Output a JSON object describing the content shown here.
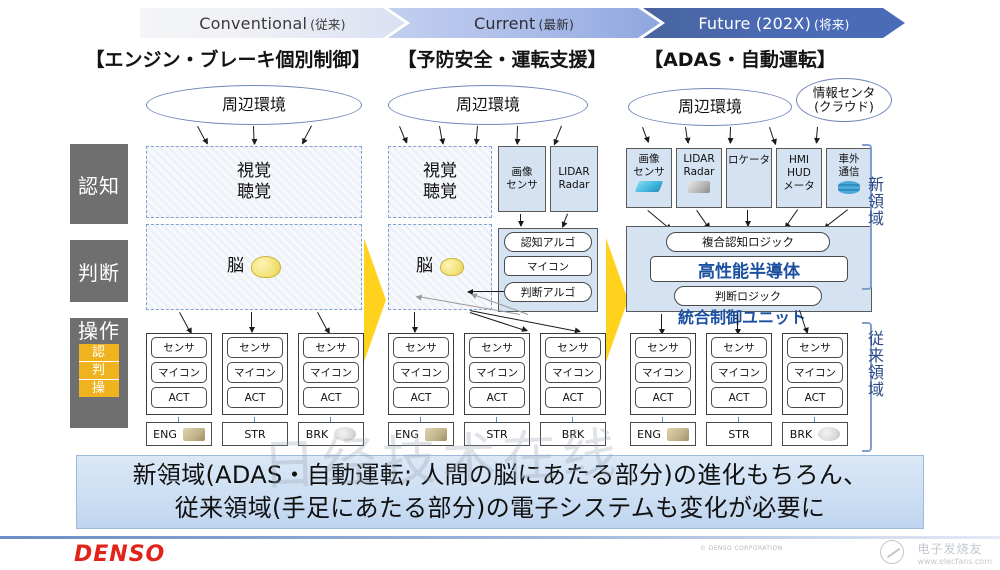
{
  "phases": [
    {
      "label": "Conventional",
      "sub": "(従来)"
    },
    {
      "label": "Current",
      "sub": "(最新)"
    },
    {
      "label": "Future (202X)",
      "sub": "(将来)"
    }
  ],
  "column_titles": [
    "【エンジン・ブレーキ個別制御】",
    "【予防安全・運転支援】",
    "【ADAS・自動運転】"
  ],
  "stage_labels": {
    "recognition": "認知",
    "judgment": "判断",
    "operation": "操作",
    "mini": [
      "認",
      "判",
      "操"
    ]
  },
  "common": {
    "environment": "周辺環境",
    "vision": "視覚",
    "hearing": "聴覚",
    "brain": "脳",
    "sensor": "センサ",
    "mcu": "マイコン",
    "act": "ACT",
    "eng": "ENG",
    "str": "STR",
    "brk": "BRK"
  },
  "column1": {
    "environment": "周辺環境",
    "sense_lines": [
      "視覚",
      "聴覚"
    ],
    "brain": "脳",
    "ecus": [
      {
        "rows": [
          "センサ",
          "マイコン",
          "ACT"
        ],
        "output": "ENG"
      },
      {
        "rows": [
          "センサ",
          "マイコン",
          "ACT"
        ],
        "output": "STR"
      },
      {
        "rows": [
          "センサ",
          "マイコン",
          "ACT"
        ],
        "output": "BRK"
      }
    ]
  },
  "column2": {
    "environment": "周辺環境",
    "sense_lines": [
      "視覚",
      "聴覚"
    ],
    "brain": "脳",
    "sensors": [
      {
        "lines": [
          "画像",
          "センサ"
        ]
      },
      {
        "lines": [
          "LIDAR",
          "Radar"
        ]
      }
    ],
    "ecu_block": [
      "認知アルゴ",
      "マイコン",
      "判断アルゴ"
    ],
    "ecus": [
      {
        "rows": [
          "センサ",
          "マイコン",
          "ACT"
        ],
        "output": "ENG"
      },
      {
        "rows": [
          "センサ",
          "マイコン",
          "ACT"
        ],
        "output": "STR"
      },
      {
        "rows": [
          "センサ",
          "マイコン",
          "ACT"
        ],
        "output": "BRK"
      }
    ]
  },
  "column3": {
    "environment": "周辺環境",
    "cloud": {
      "line1": "情報センタ",
      "line2": "(クラウド)"
    },
    "sensors": [
      {
        "lines": [
          "画像",
          "センサ"
        ],
        "icon": "camera-icon"
      },
      {
        "lines": [
          "LIDAR",
          "Radar"
        ],
        "icon": "lidar-icon"
      },
      {
        "lines": [
          "ロケータ"
        ],
        "icon": "none"
      },
      {
        "lines": [
          "HMI",
          "HUD",
          "メータ"
        ],
        "icon": "none"
      },
      {
        "lines": [
          "車外",
          "通信"
        ],
        "icon": "cloud-icon"
      }
    ],
    "integrated_unit": {
      "recognition_logic": "複合認知ロジック",
      "semiconductor": "高性能半導体",
      "judgment_logic": "判断ロジック",
      "caption": "統合制御ユニット"
    },
    "ecus": [
      {
        "rows": [
          "センサ",
          "マイコン",
          "ACT"
        ],
        "output": "ENG"
      },
      {
        "rows": [
          "センサ",
          "マイコン",
          "ACT"
        ],
        "output": "STR"
      },
      {
        "rows": [
          "センサ",
          "マイコン",
          "ACT"
        ],
        "output": "BRK"
      }
    ]
  },
  "side_labels": {
    "new_domain": "新領域",
    "legacy_domain": "従来領域"
  },
  "banner": {
    "line1": "新領域(ADAS・自動運転; 人間の脳にあたる部分)の進化もちろん、",
    "line2": "従来領域(手足にあたる部分)の電子システムも変化が必要に"
  },
  "footer": {
    "logo": "DENSO",
    "copyright": "© DENSO CORPORATION"
  },
  "watermark": {
    "big": "日经技术在线",
    "site_name": "电子发烧友",
    "site_url": "www.elecfans.com"
  },
  "colors": {
    "future_arrow": "#4a6cb8",
    "highlight_yellow": "#efb31f",
    "chevron_yellow": "#ffd21e",
    "sensor_blue": "#d4e2f2",
    "denso_red": "#e2231a",
    "side_label_blue": "#2d4a87"
  }
}
